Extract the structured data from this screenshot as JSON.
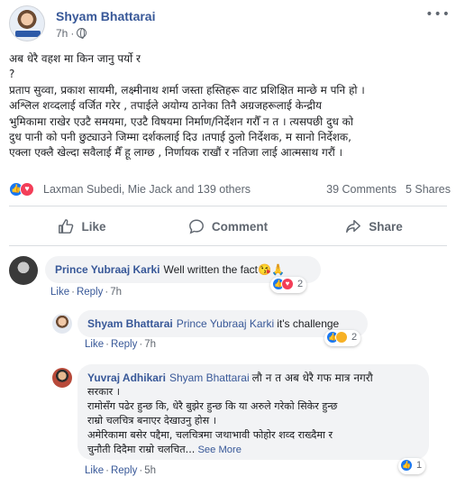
{
  "post": {
    "author": "Shyam Bhattarai",
    "time": "7h",
    "more_label": "•••",
    "lines": [
      "अब धेरै वहश मा किन जानु पर्यो र",
      "?",
      "प्रताप सुव्वा, प्रकाश सायमी, लक्ष्मीनाथ शर्मा जस्ता हस्तिहरू वाट प्रशिक्षित मान्छे म पनि हो ।",
      "अश्लिल शव्दलाई वर्जित गरेर , तपाईले अयोग्य ठानेका तिनै अग्रजहरूलाई केन्द्रीय",
      "भुमिकामा राखेर एउटै समयमा, एउटै विषयमा निर्माण/निर्देशन गरौँ न त । त्यसपछी दुध को",
      "दुध पानी को पनी छुट्याउने जिम्मा दर्शकलाई दिउ ।तपाई ठुलो निर्देशक, म सानो निर्देशक,",
      "एक्ला एक्लै खेल्दा सवैलाई मैँ हू लाग्छ , निर्णायक राखौं र नतिजा लाई आत्मसाथ गरौं ।"
    ]
  },
  "reactions": {
    "names": "Laxman Subedi, Mie Jack and 139 others",
    "comments": "39 Comments",
    "shares": "5 Shares",
    "colors": {
      "like": "#1877f2",
      "love": "#f33e58",
      "haha": "#f7b125"
    }
  },
  "actions": {
    "like": "Like",
    "comment": "Comment",
    "share": "Share"
  },
  "comments": [
    {
      "author": "Prince Yubraaj Karki",
      "text": "Well written the fact",
      "emoji": "😘🙏",
      "like": "Like",
      "reply": "Reply",
      "time": "7h",
      "reaction_count": "2"
    },
    {
      "author": "Shyam Bhattarai",
      "tag": "Prince Yubraaj Karki",
      "text": "it's challenge",
      "like": "Like",
      "reply": "Reply",
      "time": "7h",
      "reaction_count": "2"
    },
    {
      "author": "Yuvraj Adhikari",
      "tag": "Shyam Bhattarai",
      "first_line": "लौ न त अब धेरै गफ मात्र नगरौ",
      "lines": [
        "सरकार ।",
        "रामोसँग पढेर हुन्छ कि, धेरै बुझेर हुन्छ कि या अरुले गरेको सिकेर हुन्छ",
        "राम्रो चलचित्र बनाएर देखाउनु होस ।",
        "अमेरिकामा बसेर पद्दैमा, चलचित्रमा जथाभावी फोहोर शव्द राख्दैमा र",
        "चुनौती दिदैमा राम्रो चलचित..."
      ],
      "see_more": "See More",
      "like": "Like",
      "reply": "Reply",
      "time": "5h",
      "reaction_count": "1"
    }
  ]
}
